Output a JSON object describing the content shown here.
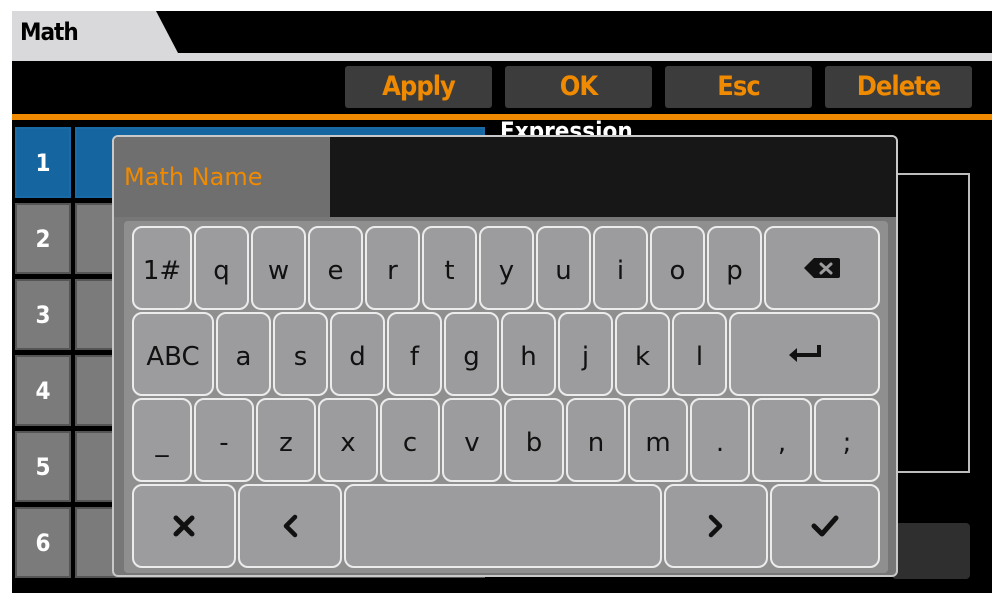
{
  "tab": {
    "title": "Math"
  },
  "toolbar": {
    "apply": "Apply",
    "ok": "OK",
    "esc": "Esc",
    "delete": "Delete"
  },
  "list": {
    "rows": [
      "1",
      "2",
      "3",
      "4",
      "5",
      "6"
    ],
    "selected": "1"
  },
  "panel": {
    "expression_label": "Expression"
  },
  "dialog": {
    "name_label": "Math Name",
    "name_value": "",
    "keys": {
      "row1": [
        "1#",
        "q",
        "w",
        "e",
        "r",
        "t",
        "y",
        "u",
        "i",
        "o",
        "p"
      ],
      "row2": [
        "ABC",
        "a",
        "s",
        "d",
        "f",
        "g",
        "h",
        "j",
        "k",
        "l"
      ],
      "row3": [
        "_",
        "-",
        "z",
        "x",
        "c",
        "v",
        "b",
        "n",
        "m",
        ".",
        ",",
        ";"
      ]
    },
    "icons": {
      "backspace": "backspace-icon",
      "enter": "enter-icon",
      "cancel": "close-icon",
      "left": "chevron-left-icon",
      "right": "chevron-right-icon",
      "confirm": "checkmark-icon"
    }
  },
  "colors": {
    "accent": "#f08a00",
    "selected": "#1565a0",
    "background": "#000000"
  }
}
